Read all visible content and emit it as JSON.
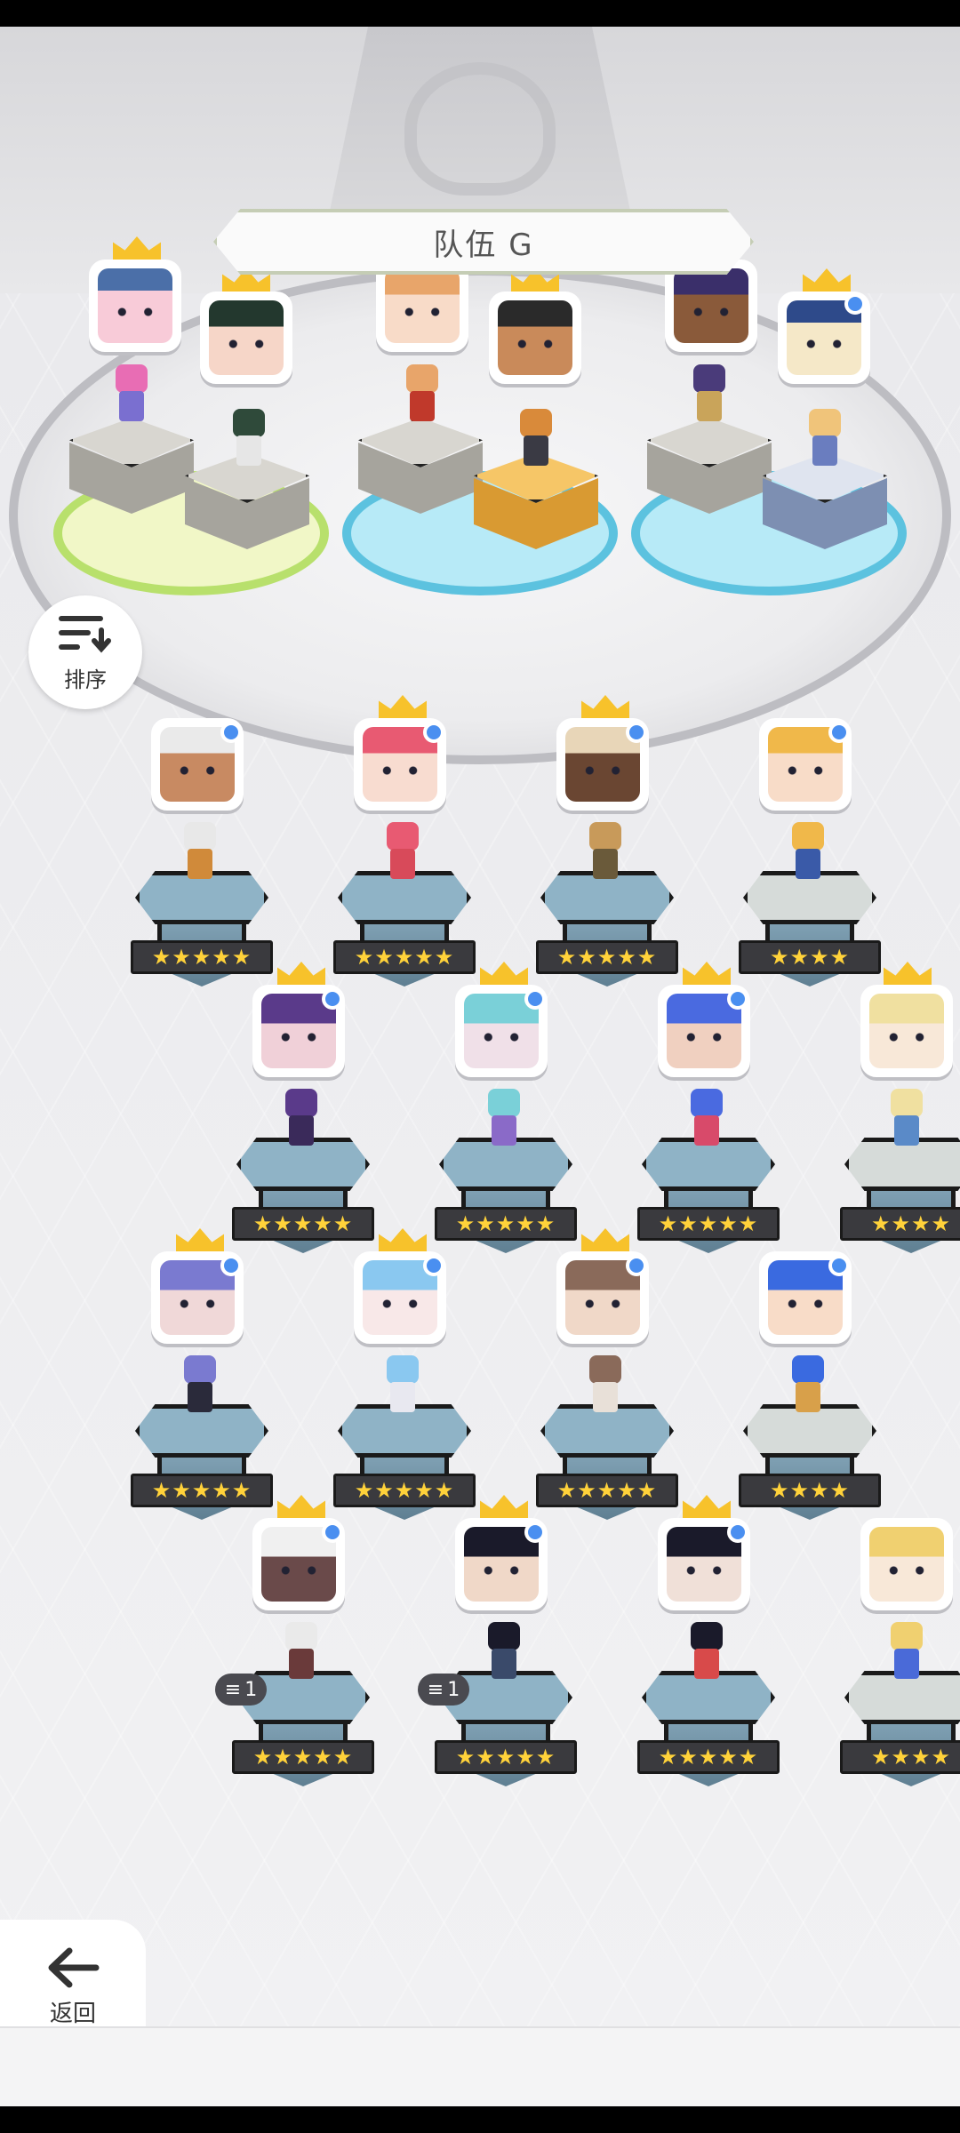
{
  "team": {
    "title": "队伍 G"
  },
  "sort_button": {
    "label": "排序",
    "icon": "sort-icon"
  },
  "back_button": {
    "label": "返回",
    "icon": "back-arrow-icon"
  },
  "stars": {
    "five": "★★★★★",
    "four": "★★★★"
  },
  "level_badge": {
    "text": "1"
  },
  "colors": {
    "crown": "#f7c22b",
    "selection_dot": "#4a8ff0",
    "pad_yellow": "#b8e06c",
    "pad_blue": "#5cc2df"
  }
}
